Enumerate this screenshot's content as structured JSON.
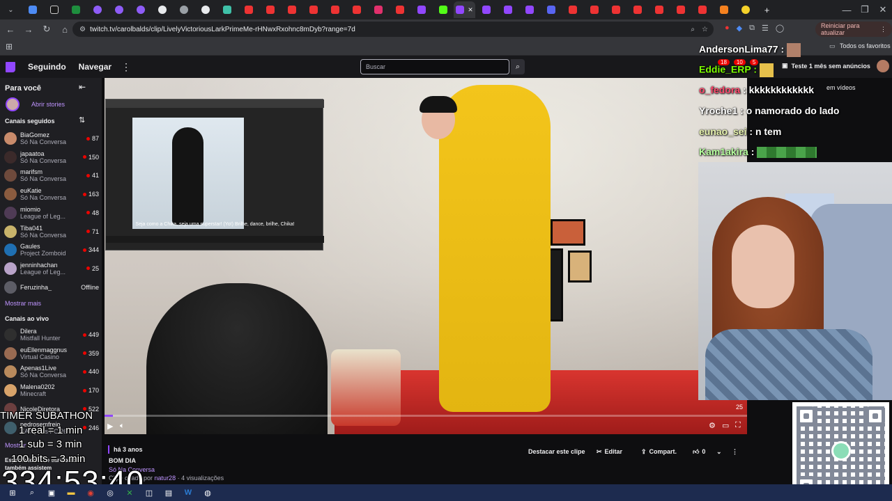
{
  "browser": {
    "url": "twitch.tv/carolbalds/clip/LivelyVictoriousLarkPrimeMe-rHNwxRxohnc8mDyb?range=7d",
    "update_label": "Reiniciar para atualizar",
    "bookmarks_label": "Todos os favoritos",
    "tab_close": "✕",
    "new_tab": "+"
  },
  "nav": {
    "following": "Seguindo",
    "browse": "Navegar",
    "search_placeholder": "Buscar",
    "promo": "Teste 1 mês sem anúncios",
    "badge1": "18",
    "badge2": "10",
    "badge3": "5"
  },
  "sidebar": {
    "for_you": "Para você",
    "stories": "Abrir stories",
    "followed_header": "Canais seguidos",
    "followed": [
      {
        "name": "BiaGomez",
        "game": "Só Na Conversa",
        "viewers": "87",
        "color": "#c98b6b"
      },
      {
        "name": "japaatoa",
        "game": "Só Na Conversa",
        "viewers": "150",
        "color": "#3b2a2a"
      },
      {
        "name": "marifsm",
        "game": "Só Na Conversa",
        "viewers": "41",
        "color": "#6e4a3c"
      },
      {
        "name": "euKatie",
        "game": "Só Na Conversa",
        "viewers": "163",
        "color": "#8a5b3f"
      },
      {
        "name": "miomio",
        "game": "League of Leg...",
        "viewers": "48",
        "color": "#4f3b55"
      },
      {
        "name": "Tiba041",
        "game": "Só Na Conversa",
        "viewers": "71",
        "color": "#c8b36a"
      },
      {
        "name": "Gaules",
        "game": "Project Zomboid",
        "viewers": "344",
        "color": "#1f6fb2"
      },
      {
        "name": "jenninhachan",
        "game": "League of Leg...",
        "viewers": "25",
        "color": "#b9a3c9"
      },
      {
        "name": "Feruzinha_",
        "game": "",
        "viewers": "Offline",
        "color": "#5d5d66"
      }
    ],
    "show_more": "Mostrar mais",
    "live_header": "Canais ao vivo",
    "live": [
      {
        "name": "Dilera",
        "game": "Mistfall Hunter",
        "viewers": "449",
        "color": "#2f2f2f"
      },
      {
        "name": "euEllenmaggnus",
        "game": "Virtual Casino",
        "viewers": "359",
        "color": "#9a6b52"
      },
      {
        "name": "Apenas1Live",
        "game": "Só Na Conversa",
        "viewers": "440",
        "color": "#b98a5c"
      },
      {
        "name": "Malena0202",
        "game": "Minecraft",
        "viewers": "170",
        "color": "#d8a36a"
      },
      {
        "name": "NicoleDiretora",
        "game": "",
        "viewers": "522",
        "color": "#6c3f3f"
      },
      {
        "name": "pedrosemfreio",
        "game": "EA Sports FC 26",
        "viewers": "246",
        "color": "#3f5f6c"
      }
    ],
    "show_more2": "Mostrar",
    "also_watch": "Espectadores de carolbalds também assistem"
  },
  "video": {
    "pip_subtitle": "Seja como a Chika, seja uma superstar! (Yo!) Brilhe, dance, brilhe, Chika!",
    "time_badge": "25"
  },
  "chat": [
    {
      "user": "AndersonLima77",
      "msg": "",
      "color": "#ffffff"
    },
    {
      "user": "Eddie_ERP",
      "msg": "",
      "color": "#7cfc00"
    },
    {
      "user": "o_fedora",
      "msg": "kkkkkkkkkkkk",
      "color": "#ff4a6e"
    },
    {
      "user": "Yroche1",
      "msg": "o namorado do lado",
      "color": "#ffffff"
    },
    {
      "user": "eunao_sei",
      "msg": "n tem",
      "color": "#e9f5b0"
    },
    {
      "user": "Kam1akira",
      "msg": "",
      "color": "#b6ff9e"
    }
  ],
  "chat_overlay_hint": "em vídeos",
  "clip": {
    "age": "há 3 anos",
    "title": "BOM DIA",
    "category": "Só Na Conversa",
    "creator_prefix": "Clipe criado por",
    "creator": "natur28",
    "views": "· 4 visualizações",
    "highlight": "Destacar este clipe",
    "edit": "Editar",
    "share": "Compart.",
    "likes": "0"
  },
  "overlay": {
    "timer_title": "TIMER SUBATHON",
    "rule1": "1 real = 1 min",
    "rule2": "1 sub = 3 min",
    "rule3": "100 bits = 3 min",
    "countdown": "334:53:40"
  },
  "colors": {
    "accent": "#9147ff",
    "live": "#eb0400"
  }
}
